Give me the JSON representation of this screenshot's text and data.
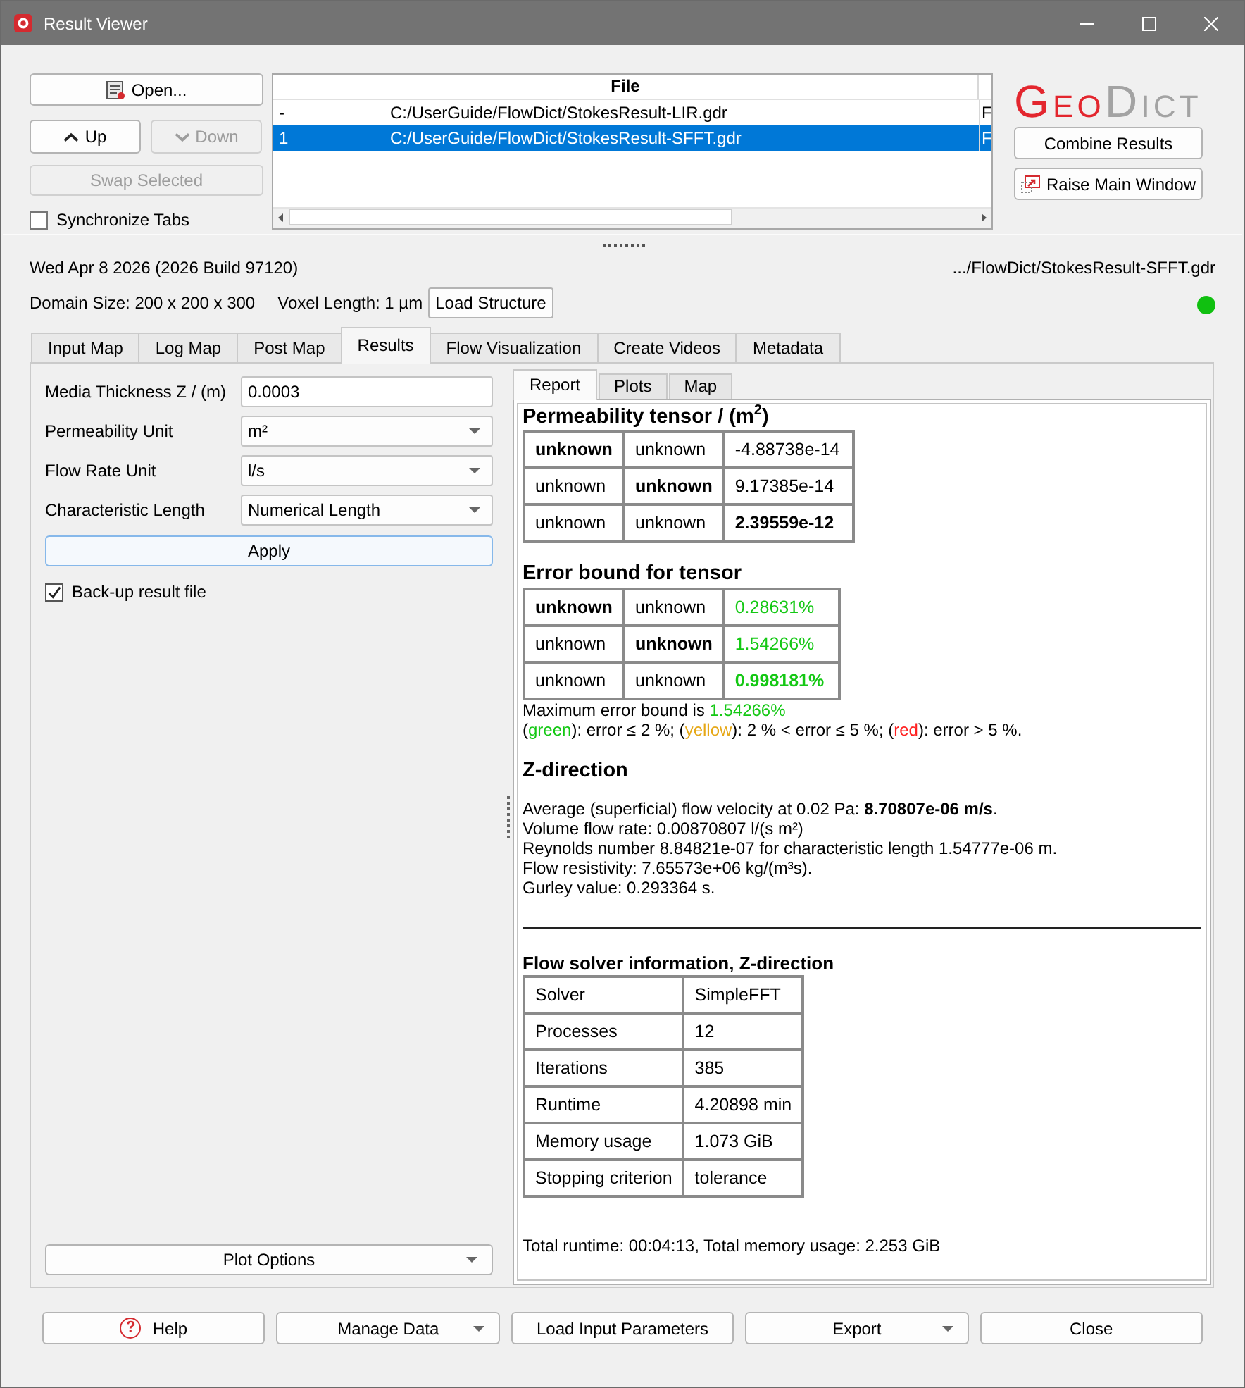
{
  "window": {
    "title": "Result Viewer"
  },
  "toolbar": {
    "open": {
      "label": "Open...",
      "disabled": false
    },
    "up": {
      "label": "Up",
      "disabled": false
    },
    "down": {
      "label": "Down",
      "disabled": true
    },
    "swap": {
      "label": "Swap Selected",
      "disabled": true
    },
    "synchronize_tabs": {
      "label": "Synchronize Tabs",
      "checked": false
    }
  },
  "file_table": {
    "columns": [
      {
        "label": "File"
      }
    ],
    "rows": [
      {
        "row_label": "-",
        "file": "C:/UserGuide/FlowDict/StokesResult-LIR.gdr",
        "column_3": "F",
        "selected": false
      },
      {
        "row_label": "1",
        "file": "C:/UserGuide/FlowDict/StokesResult-SFFT.gdr",
        "column_3": "F",
        "selected": true
      }
    ]
  },
  "logo": {
    "parts": [
      {
        "text": "Geo",
        "color": "#e3262e"
      },
      {
        "text": "Dict",
        "color": "#a3a3a3"
      }
    ]
  },
  "side_buttons": [
    {
      "label": "Combine Results",
      "kind": "plain"
    },
    {
      "label": "Raise Main Window",
      "kind": "raise"
    }
  ],
  "info": {
    "date": "Wed Apr 8 2026 (2026 Build 97120)",
    "file": ".../FlowDict/StokesResult-SFFT.gdr",
    "domain_size": "Domain Size: 200 x 200 x 300",
    "voxel_length": "Voxel Length: 1 µm",
    "load_button": "Load Structure",
    "status_ok": true
  },
  "tabs": [
    {
      "label": "Input Map",
      "selected": false
    },
    {
      "label": "Log Map",
      "selected": false
    },
    {
      "label": "Post Map",
      "selected": false
    },
    {
      "label": "Results",
      "selected": true
    },
    {
      "label": "Flow Visualization",
      "selected": false
    },
    {
      "label": "Create Videos",
      "selected": false
    },
    {
      "label": "Metadata",
      "selected": false
    }
  ],
  "settings": {
    "fields": [
      {
        "kind": "input",
        "label": "Media Thickness Z / (m)",
        "value": "0.0003"
      },
      {
        "kind": "combo",
        "label": "Permeability Unit",
        "value": "m²"
      },
      {
        "kind": "combo",
        "label": "Flow Rate Unit",
        "value": "l/s"
      },
      {
        "kind": "combo",
        "label": "Characteristic Length",
        "value": "Numerical Length"
      }
    ],
    "apply": "Apply",
    "backup": {
      "label": "Back-up result file",
      "checked": true
    },
    "plot_options": "Plot Options"
  },
  "report_tabs": [
    {
      "label": "Report",
      "selected": true
    },
    {
      "label": "Plots",
      "selected": false
    },
    {
      "label": "Map",
      "selected": false
    }
  ],
  "report": {
    "permeability": {
      "title": "Permeability tensor / (m$^{2}$)",
      "rows": [
        [
          {
            "text": "unknown",
            "bold": true
          },
          {
            "text": "unknown",
            "bold": false
          },
          {
            "text": "-4.88738e-14",
            "bold": false
          }
        ],
        [
          {
            "text": "unknown",
            "bold": false
          },
          {
            "text": "unknown",
            "bold": true
          },
          {
            "text": "9.17385e-14",
            "bold": false
          }
        ],
        [
          {
            "text": "unknown",
            "bold": false
          },
          {
            "text": "unknown",
            "bold": false
          },
          {
            "text": "2.39559e-12",
            "bold": true
          }
        ]
      ]
    },
    "error_bound": {
      "title": "Error bound for tensor",
      "rows": [
        [
          {
            "text": "unknown",
            "bold": true
          },
          {
            "text": "unknown",
            "bold": false
          },
          {
            "text": "0.28631%",
            "bold": false,
            "color": "#14c814"
          }
        ],
        [
          {
            "text": "unknown",
            "bold": false
          },
          {
            "text": "unknown",
            "bold": true
          },
          {
            "text": "1.54266%",
            "bold": false,
            "color": "#14c814"
          }
        ],
        [
          {
            "text": "unknown",
            "bold": false
          },
          {
            "text": "unknown",
            "bold": false
          },
          {
            "text": "0.998181%",
            "bold": true,
            "color": "#14c814"
          }
        ]
      ],
      "maximum": [
        {
          "text": "Maximum error bound is "
        },
        {
          "text": "1.54266%",
          "color": "#14c814"
        }
      ],
      "legend": [
        {
          "text": "("
        },
        {
          "text": "green",
          "color": "#14c814"
        },
        {
          "text": "): error ≤ 2 %; ("
        },
        {
          "text": "yellow",
          "color": "#e6a817"
        },
        {
          "text": "): 2 % < error ≤ 5 %; ("
        },
        {
          "text": "red",
          "color": "#ff2020"
        },
        {
          "text": "): error > 5 %."
        }
      ]
    },
    "direction": {
      "title": "Z-direction",
      "lines": [
        "Average (superficial) flow velocity at 0.02 Pa: **8.70807e-06 m/s**.",
        "Volume flow rate: 0.00870807 l/(s m²)",
        "Reynolds number 8.84821e-07 for characteristic length 1.54777e-06 m.",
        "Flow resistivity: 7.65573e+06 kg/(m³s).",
        "Gurley value: 0.293364 s."
      ]
    },
    "solver": {
      "title": "Flow solver information, Z-direction",
      "rows": [
        [
          "Solver",
          "SimpleFFT"
        ],
        [
          "Processes",
          "12"
        ],
        [
          "Iterations",
          "385"
        ],
        [
          "Runtime",
          "4.20898 min"
        ],
        [
          "Memory usage",
          "1.073 GiB"
        ],
        [
          "Stopping criterion",
          "tolerance"
        ]
      ]
    },
    "total": "Total runtime: 00:04:13, Total memory usage: 2.253 GiB"
  },
  "buttons": [
    {
      "label": "Help",
      "kind": "help",
      "icon": "?"
    },
    {
      "label": "Manage Data",
      "kind": "menu"
    },
    {
      "label": "Load Input Parameters",
      "kind": "plain"
    },
    {
      "label": "Export",
      "kind": "menu"
    },
    {
      "label": "Close",
      "kind": "plain"
    }
  ]
}
